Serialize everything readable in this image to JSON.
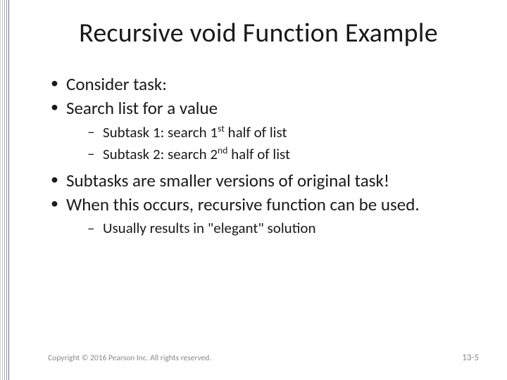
{
  "title": "Recursive void Function Example",
  "bullets": {
    "b1": "Consider task:",
    "b2": "Search list for a value",
    "b2_sub1_pre": "Subtask 1: search 1",
    "b2_sub1_sup": "st",
    "b2_sub1_post": " half of list",
    "b2_sub2_pre": "Subtask 2: search 2",
    "b2_sub2_sup": "nd",
    "b2_sub2_post": " half of list",
    "b3": "Subtasks are smaller versions of original task!",
    "b4": "When this occurs, recursive function can be used.",
    "b4_sub1": "Usually results in \"elegant\" solution"
  },
  "footer": {
    "copyright": "Copyright © 2016 Pearson Inc. All rights reserved.",
    "page": "13-5"
  }
}
